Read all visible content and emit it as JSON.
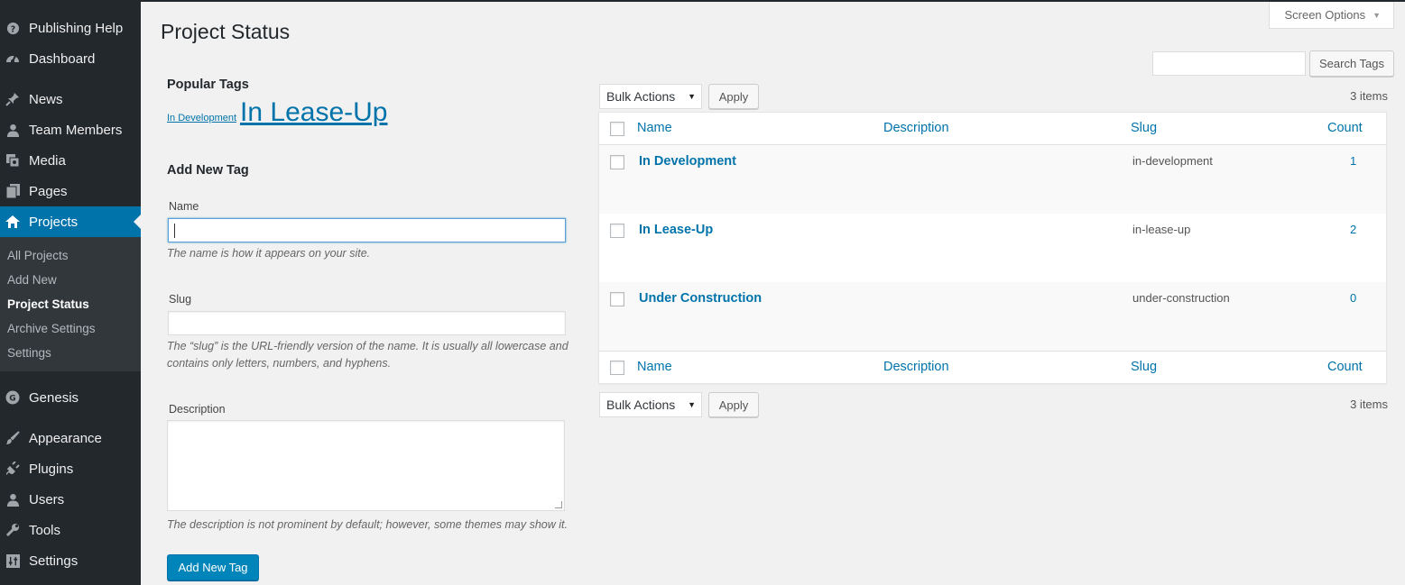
{
  "sidebar": {
    "menu": [
      {
        "label": "Publishing Help",
        "icon": "help-icon"
      },
      {
        "label": "Dashboard",
        "icon": "dashboard-icon"
      },
      {
        "label": "News",
        "icon": "pin-icon"
      },
      {
        "label": "Team Members",
        "icon": "user-icon"
      },
      {
        "label": "Media",
        "icon": "media-icon"
      },
      {
        "label": "Pages",
        "icon": "pages-icon"
      },
      {
        "label": "Projects",
        "icon": "home-icon"
      },
      {
        "label": "Genesis",
        "icon": "genesis-icon"
      },
      {
        "label": "Appearance",
        "icon": "brush-icon"
      },
      {
        "label": "Plugins",
        "icon": "plugin-icon"
      },
      {
        "label": "Users",
        "icon": "user-icon"
      },
      {
        "label": "Tools",
        "icon": "wrench-icon"
      },
      {
        "label": "Settings",
        "icon": "settings-icon"
      }
    ],
    "submenu": [
      "All Projects",
      "Add New",
      "Project Status",
      "Archive Settings",
      "Settings"
    ],
    "current_menu": "Projects",
    "current_submenu": "Project Status"
  },
  "header": {
    "title": "Project Status",
    "screen_options": "Screen Options"
  },
  "form": {
    "popular_tags_heading": "Popular Tags",
    "tag_cloud": [
      {
        "label": "In Development",
        "weight": "small"
      },
      {
        "label": "In Lease-Up",
        "weight": "large"
      }
    ],
    "add_heading": "Add New Tag",
    "name_label": "Name",
    "name_value": "",
    "name_help": "The name is how it appears on your site.",
    "slug_label": "Slug",
    "slug_value": "",
    "slug_help_1": "The “slug” is the URL-friendly version of the name. It is usually all lowercase and",
    "slug_help_2": "contains only letters, numbers, and hyphens.",
    "description_label": "Description",
    "description_value": "",
    "description_help": "The description is not prominent by default; however, some themes may show it.",
    "submit_label": "Add New Tag"
  },
  "search": {
    "value": "",
    "button_label": "Search Tags"
  },
  "tablenav": {
    "bulk_actions": "Bulk Actions",
    "apply_label": "Apply",
    "items_count": "3 items"
  },
  "table": {
    "columns": [
      "Name",
      "Description",
      "Slug",
      "Count"
    ],
    "rows": [
      {
        "name": "In Development",
        "description": "",
        "slug": "in-development",
        "count": "1"
      },
      {
        "name": "In Lease-Up",
        "description": "",
        "slug": "in-lease-up",
        "count": "2"
      },
      {
        "name": "Under Construction",
        "description": "",
        "slug": "under-construction",
        "count": "0"
      }
    ]
  },
  "colors": {
    "sidebar_bg": "#23282d",
    "accent": "#0073aa",
    "primary_button": "#0085ba",
    "page_bg": "#f1f1f1"
  }
}
